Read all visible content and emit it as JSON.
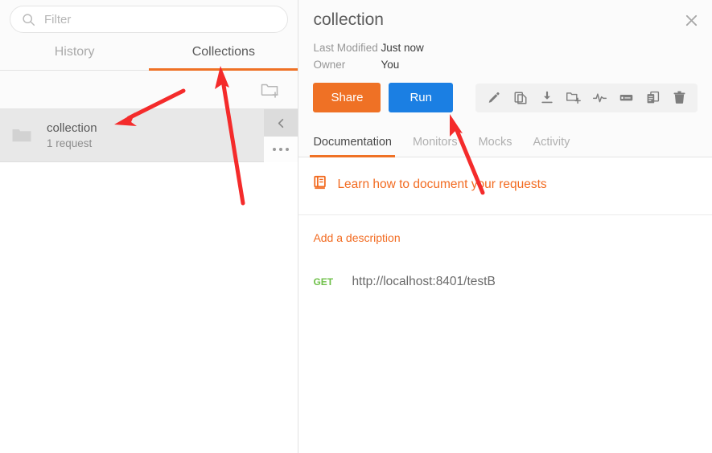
{
  "sidebar": {
    "filter": {
      "placeholder": "Filter",
      "value": "",
      "icon": "search-icon"
    },
    "tabs": [
      {
        "label": "History",
        "active": false
      },
      {
        "label": "Collections",
        "active": true
      }
    ],
    "new_folder_icon": "new-folder-icon",
    "collections": [
      {
        "name": "collection",
        "subtitle": "1 request",
        "folder_icon": "folder-icon",
        "collapse_icon": "chevron-left-icon",
        "more_icon": "more-options-icon"
      }
    ]
  },
  "detail": {
    "title": "collection",
    "close_icon": "close-icon",
    "meta": [
      {
        "key": "Last Modified",
        "value": "Just now"
      },
      {
        "key": "Owner",
        "value": "You"
      }
    ],
    "actions": {
      "share_label": "Share",
      "run_label": "Run",
      "icons": [
        "edit-pencil-icon",
        "duplicate-icon",
        "export-download-icon",
        "add-folder-icon",
        "monitor-pulse-icon",
        "mock-server-icon",
        "documentation-icon",
        "delete-trash-icon"
      ]
    },
    "tabs": [
      {
        "label": "Documentation",
        "active": true
      },
      {
        "label": "Monitors",
        "active": false
      },
      {
        "label": "Mocks",
        "active": false
      },
      {
        "label": "Activity",
        "active": false
      }
    ],
    "body": {
      "learn_icon": "book-icon",
      "learn_link": "Learn how to document your requests",
      "add_description": "Add a description",
      "requests": [
        {
          "method": "GET",
          "url": "http://localhost:8401/testB"
        }
      ]
    }
  },
  "annotations": {
    "arrow_color": "#f42b2b",
    "arrows": [
      {
        "name": "arrow-to-collection-item",
        "target": "collection list item"
      },
      {
        "name": "arrow-to-collections-tab",
        "target": "Collections tab"
      },
      {
        "name": "arrow-to-run-button",
        "target": "Run button"
      }
    ]
  },
  "colors": {
    "accent_orange": "#ef7125",
    "run_blue": "#1b7fe3",
    "get_green": "#6fc04a",
    "annotation_red": "#f42b2b"
  }
}
